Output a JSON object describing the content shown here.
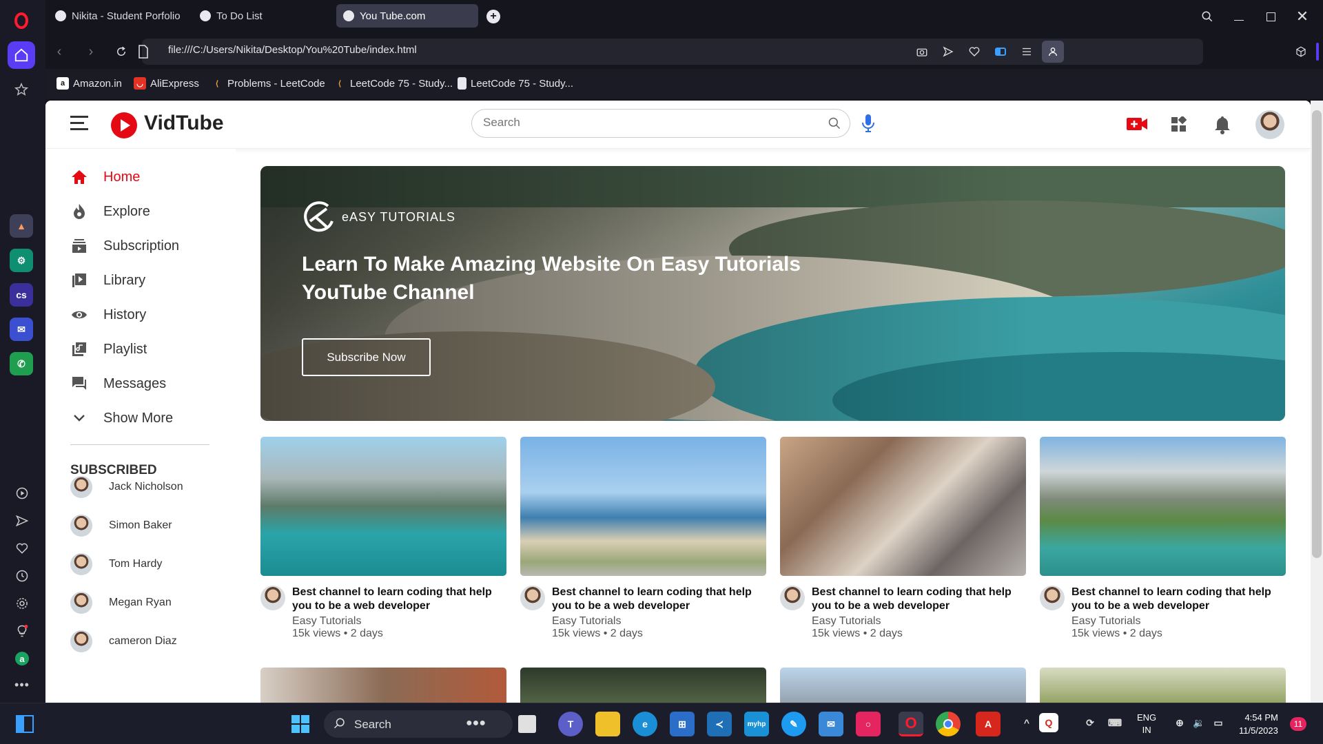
{
  "browser": {
    "tabs": [
      {
        "label": "Nikita - Student Porfolio"
      },
      {
        "label": "To Do List"
      },
      {
        "label": "You Tube.com"
      }
    ],
    "url": "file:///C:/Users/Nikita/Desktop/You%20Tube/index.html",
    "bookmarks": [
      {
        "label": "Amazon.in"
      },
      {
        "label": "AliExpress"
      },
      {
        "label": "Problems - LeetCode"
      },
      {
        "label": "LeetCode 75 - Study..."
      },
      {
        "label": "LeetCode 75 - Study..."
      }
    ]
  },
  "app": {
    "logo": "VidTube",
    "search_placeholder": "Search",
    "accent": "#e50914"
  },
  "sidebar": {
    "items": [
      {
        "label": "Home",
        "icon": "home-icon",
        "active": true
      },
      {
        "label": "Explore",
        "icon": "flame-icon"
      },
      {
        "label": "Subscription",
        "icon": "subscription-icon"
      },
      {
        "label": "Library",
        "icon": "library-icon"
      },
      {
        "label": "History",
        "icon": "eye-icon"
      },
      {
        "label": "Playlist",
        "icon": "playlist-icon"
      },
      {
        "label": "Messages",
        "icon": "messages-icon"
      },
      {
        "label": "Show More",
        "icon": "chevron-down-icon"
      }
    ],
    "subscribed_heading": "SUBSCRIBED",
    "subscribed": [
      {
        "name": "Jack Nicholson"
      },
      {
        "name": "Simon Baker"
      },
      {
        "name": "Tom Hardy"
      },
      {
        "name": "Megan Ryan"
      },
      {
        "name": "cameron Diaz"
      }
    ]
  },
  "banner": {
    "brand": "eASY TUTORIALS",
    "title": "Learn To Make Amazing Website On Easy Tutorials YouTube Channel",
    "button": "Subscribe Now"
  },
  "videos": [
    {
      "title": "Best channel to learn coding that help you to be a web developer",
      "channel": "Easy Tutorials",
      "meta": "15k views • 2 days"
    },
    {
      "title": "Best channel to learn coding that help you to be a web developer",
      "channel": "Easy Tutorials",
      "meta": "15k views • 2 days"
    },
    {
      "title": "Best channel to learn coding that help you to be a web developer",
      "channel": "Easy Tutorials",
      "meta": "15k views • 2 days"
    },
    {
      "title": "Best channel to learn coding that help you to be a web developer",
      "channel": "Easy Tutorials",
      "meta": "15k views • 2 days"
    }
  ],
  "taskbar": {
    "search": "Search",
    "lang": "ENG",
    "region": "IN",
    "time": "4:54 PM",
    "date": "11/5/2023",
    "notifications": "11"
  }
}
